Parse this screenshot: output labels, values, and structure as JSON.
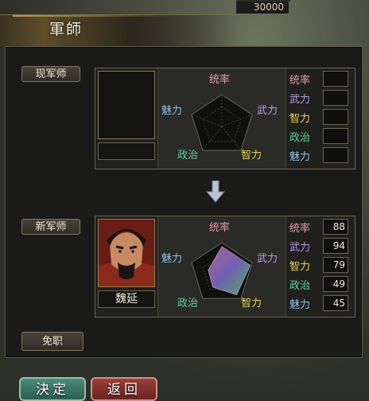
{
  "top_counter": "30000",
  "title": "軍師",
  "current": {
    "tag": "现军师",
    "name": "",
    "radar_labels": {
      "top": "统率",
      "right": "武力",
      "bottom_right": "智力",
      "bottom_left": "政治",
      "left": "魅力"
    },
    "stats": [
      {
        "label": "统率",
        "value": "",
        "color": "#e49bb4"
      },
      {
        "label": "武力",
        "value": "",
        "color": "#b99de4"
      },
      {
        "label": "智力",
        "value": "",
        "color": "#e6d44c"
      },
      {
        "label": "政治",
        "value": "",
        "color": "#5ed29c"
      },
      {
        "label": "魅力",
        "value": "",
        "color": "#8cc0f0"
      }
    ]
  },
  "new": {
    "tag": "新军师",
    "name": "魏延",
    "radar_labels": {
      "top": "统率",
      "right": "武力",
      "bottom_right": "智力",
      "bottom_left": "政治",
      "left": "魅力"
    },
    "stats": [
      {
        "label": "统率",
        "value": "88",
        "color": "#e49bb4"
      },
      {
        "label": "武力",
        "value": "94",
        "color": "#b99de4"
      },
      {
        "label": "智力",
        "value": "79",
        "color": "#e6d44c"
      },
      {
        "label": "政治",
        "value": "49",
        "color": "#5ed29c"
      },
      {
        "label": "魅力",
        "value": "45",
        "color": "#8cc0f0"
      }
    ]
  },
  "dismiss_label": "免职",
  "buttons": {
    "confirm": "決定",
    "back": "返回"
  }
}
